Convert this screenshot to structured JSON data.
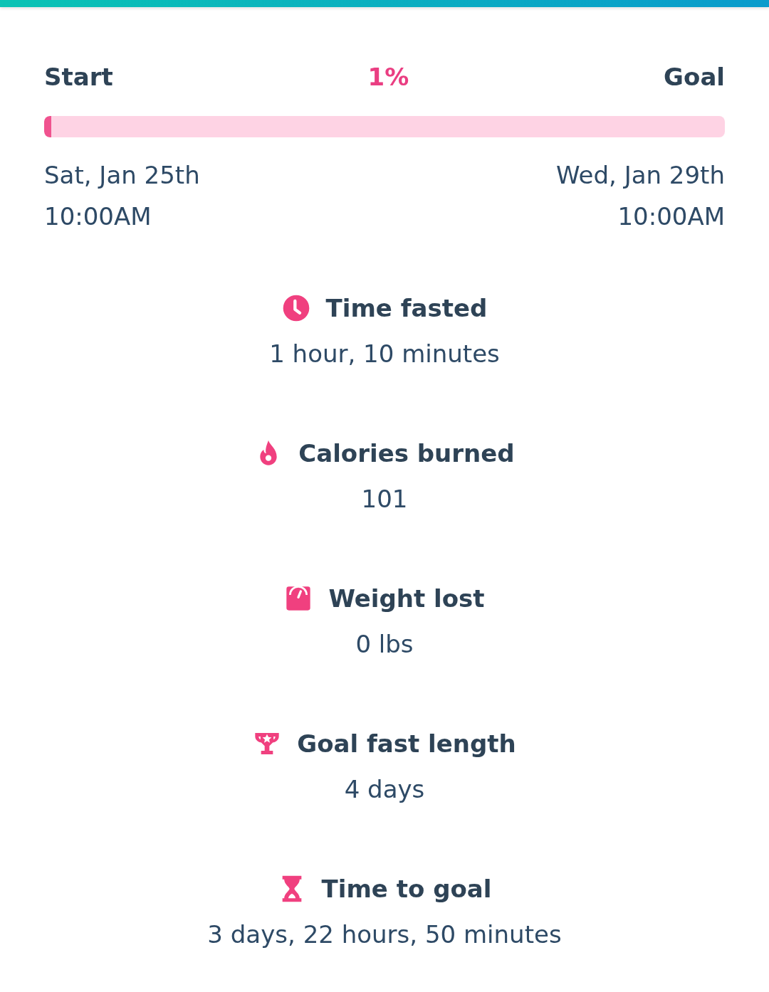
{
  "progress": {
    "start_label": "Start",
    "percent": "1%",
    "goal_label": "Goal",
    "level": 0.01
  },
  "start": {
    "date": "Sat, Jan 25th",
    "time": "10:00AM"
  },
  "goal": {
    "date": "Wed, Jan 29th",
    "time": "10:00AM"
  },
  "stats": [
    {
      "kind": "clock",
      "title": "Time fasted",
      "value": "1 hour, 10 minutes"
    },
    {
      "kind": "flame",
      "title": "Calories burned",
      "value": "101"
    },
    {
      "kind": "scale",
      "title": "Weight lost",
      "value": "0 lbs"
    },
    {
      "kind": "trophy",
      "title": "Goal fast length",
      "value": "4 days"
    },
    {
      "kind": "hourglass",
      "title": "Time to goal",
      "value": "3 days, 22 hours, 50 minutes"
    }
  ]
}
